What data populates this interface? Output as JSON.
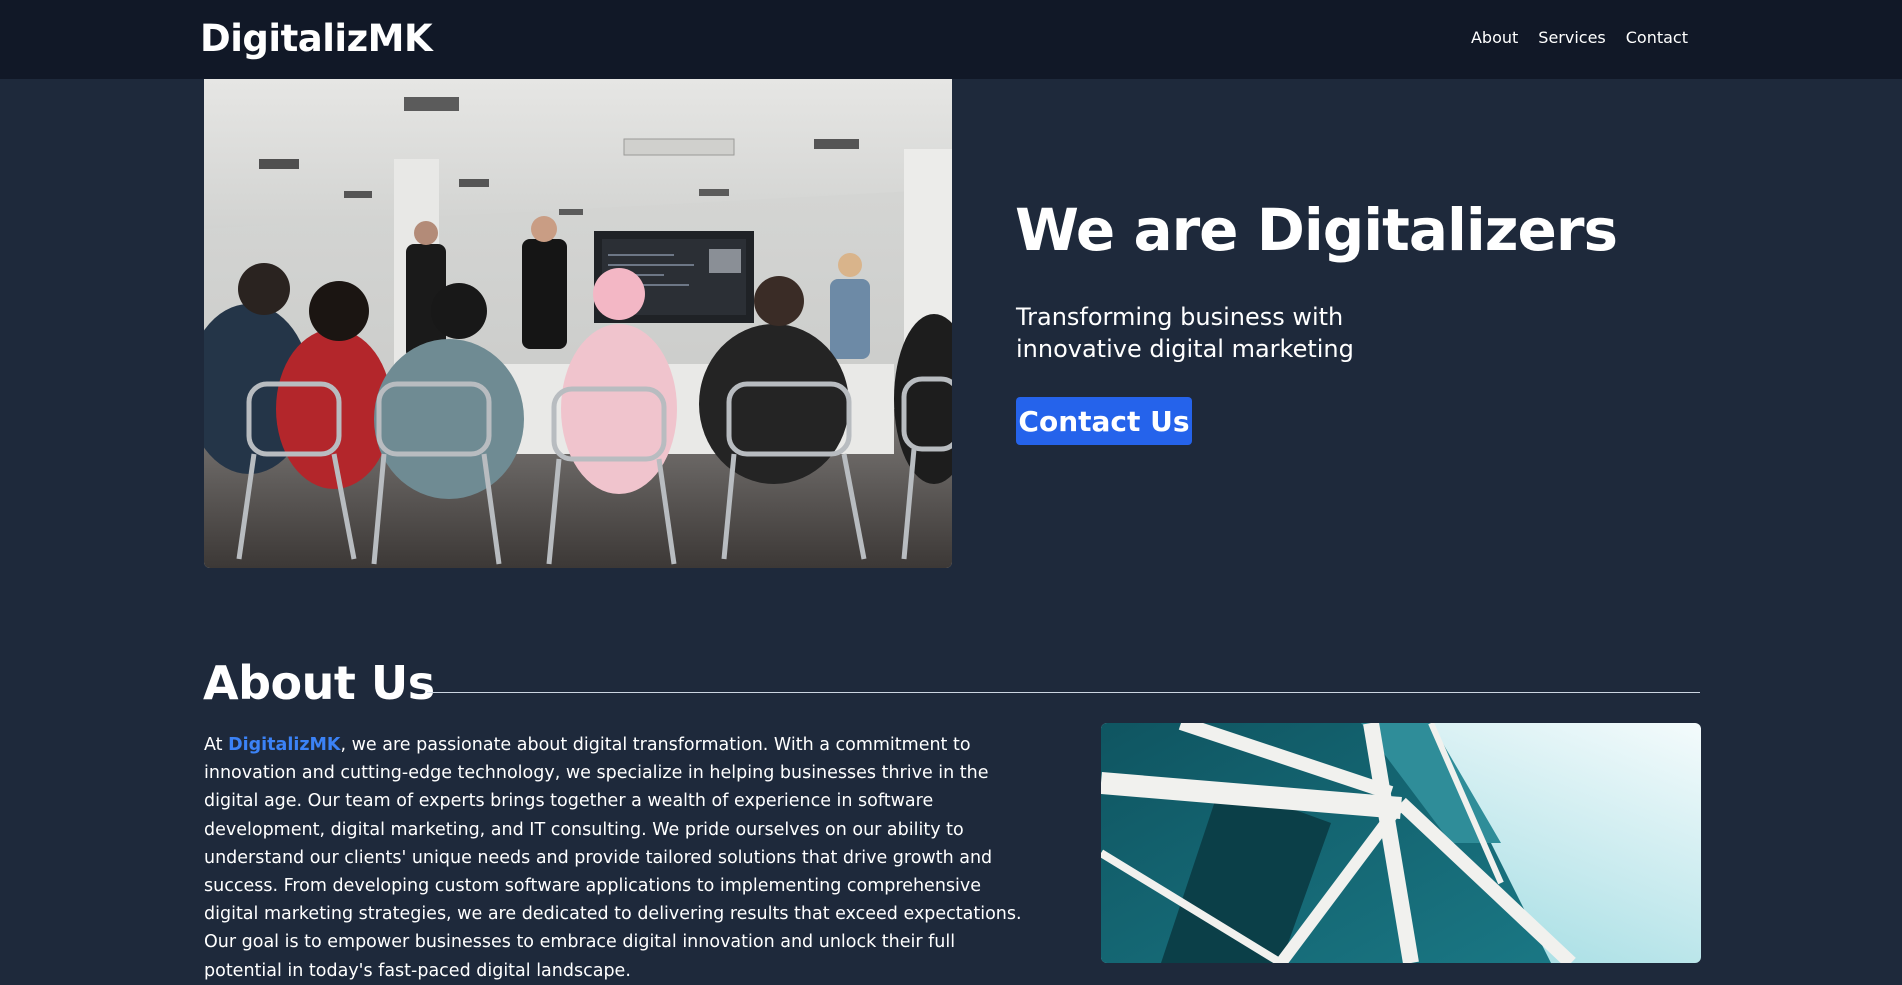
{
  "header": {
    "brand": "DigitalizMK",
    "nav": [
      {
        "label": "About"
      },
      {
        "label": "Services"
      },
      {
        "label": "Contact"
      }
    ]
  },
  "hero": {
    "title": "We are Digitalizers",
    "subtitle": "Transforming business with innovative digital marketing",
    "cta_label": "Contact Us",
    "image": "classroom-presentation-photo"
  },
  "about": {
    "title": "About Us",
    "text_prefix": "At ",
    "text_highlight": "DigitalizMK",
    "text_body": ", we are passionate about digital transformation. With a commitment to innovation and cutting-edge technology, we specialize in helping businesses thrive in the digital age. Our team of experts brings together a wealth of experience in software development, digital marketing, and IT consulting. We pride ourselves on our ability to understand our clients' unique needs and provide tailored solutions that drive growth and success. From developing custom software applications to implementing comprehensive digital marketing strategies, we are dedicated to delivering results that exceed expectations. Our goal is to empower businesses to embrace digital innovation and unlock their full potential in today's fast-paced digital landscape.",
    "image": "glass-building-photo"
  },
  "colors": {
    "page_bg": "#1e293b",
    "header_bg": "#111827",
    "accent": "#2563eb",
    "highlight": "#3b82f6"
  }
}
